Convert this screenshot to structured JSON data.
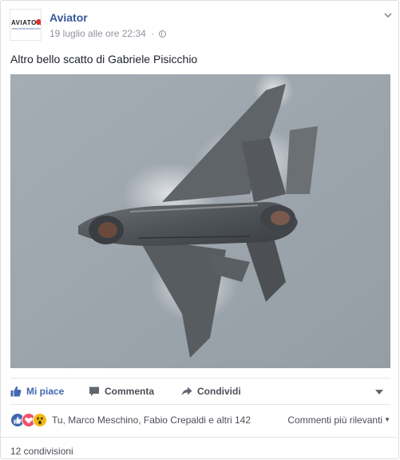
{
  "post": {
    "page_name": "Aviator",
    "avatar_logo_text": "AVIATOR",
    "avatar_logo_sub": "www.aviatorsocial.com",
    "timestamp": "19 luglio alle ore 22:34",
    "separator": "·",
    "privacy_icon": "globe-icon",
    "text": "Altro bello scatto di Gabriele Pisicchio"
  },
  "actions": {
    "like_label": "Mi piace",
    "comment_label": "Commenta",
    "share_label": "Condividi"
  },
  "reactions": {
    "icons": [
      "like-icon",
      "love-icon",
      "wow-icon"
    ],
    "summary": "Tu, Marco Meschino, Fabio Crepaldi e altri 142",
    "sort_label": "Commenti più rilevanti"
  },
  "shares_text": "12 condivisioni",
  "colors": {
    "link": "#365899",
    "like_active": "#4267b2",
    "love": "#f25268",
    "wow": "#f0ba15",
    "sky": "#9aa2aa"
  }
}
